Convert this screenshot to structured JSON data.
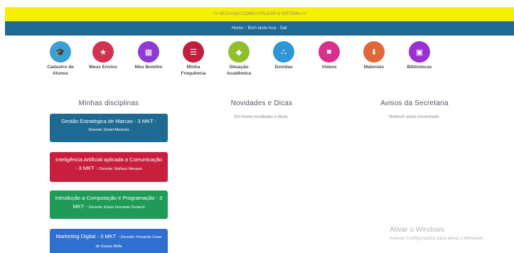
{
  "banner": {
    "text": ">> VEJA AQUI COMO UTILIZAR O SISTEMA <<"
  },
  "userbar": {
    "greeting": "Home :: Bom tarde Ana - Sair"
  },
  "menu": [
    {
      "label": "Cadastro de Alunos",
      "icon": "graduation-cap-icon",
      "color": "#3a9fd4",
      "glyph": "🎓"
    },
    {
      "label": "Meus Envios",
      "icon": "star-icon",
      "color": "#d0324f",
      "glyph": "★"
    },
    {
      "label": "Meu Boletim",
      "icon": "grid-icon",
      "color": "#8e3ad6",
      "glyph": "▦"
    },
    {
      "label": "Minha Frequência",
      "icon": "list-icon",
      "color": "#c21f3c",
      "glyph": "☰"
    },
    {
      "label": "Situação Acadêmica",
      "icon": "tag-icon",
      "color": "#8fbf2d",
      "glyph": "◆"
    },
    {
      "label": "Dúvidas",
      "icon": "sitemap-icon",
      "color": "#2f97d6",
      "glyph": "⛬"
    },
    {
      "label": "Vídeos",
      "icon": "video-icon",
      "color": "#d9308d",
      "glyph": "■"
    },
    {
      "label": "Materiais",
      "icon": "download-icon",
      "color": "#e0673a",
      "glyph": "⬇"
    },
    {
      "label": "Bibliotecas",
      "icon": "book-icon",
      "color": "#9a2fd4",
      "glyph": "▣"
    }
  ],
  "columns": {
    "disciplinas": {
      "title": "Minhas disciplinas"
    },
    "novidades": {
      "title": "Novidades e Dicas",
      "text": "Em breve novidades e dicas."
    },
    "avisos": {
      "title": "Avisos da Secretaria",
      "text": "Nenhum aviso encontrado."
    }
  },
  "disciplinas": [
    {
      "name": "Gestão Estratégica de Marcas - 3 MKT",
      "docente": "Docente: Daniel Menezes",
      "color": "#1e6a92"
    },
    {
      "name": "Inteligência Artificial aplicada a Comunicação - 3 MKT",
      "docente": "Docente: Nathaus Marques",
      "color": "#c91f3e"
    },
    {
      "name": "Introdução a Computação e Programação - 3 MKT",
      "docente": "Docente: Edson Fernando Fumachi",
      "color": "#1f9a57"
    },
    {
      "name": "Marketing Digital - 3 MKT",
      "docente": "Docente: Fernando Cesar de Guaraz Molla",
      "color": "#2e6fd0"
    }
  ],
  "watermark": {
    "title": "Ativar o Windows",
    "subtitle": "Acesse Configurações para ativar o Windows."
  }
}
